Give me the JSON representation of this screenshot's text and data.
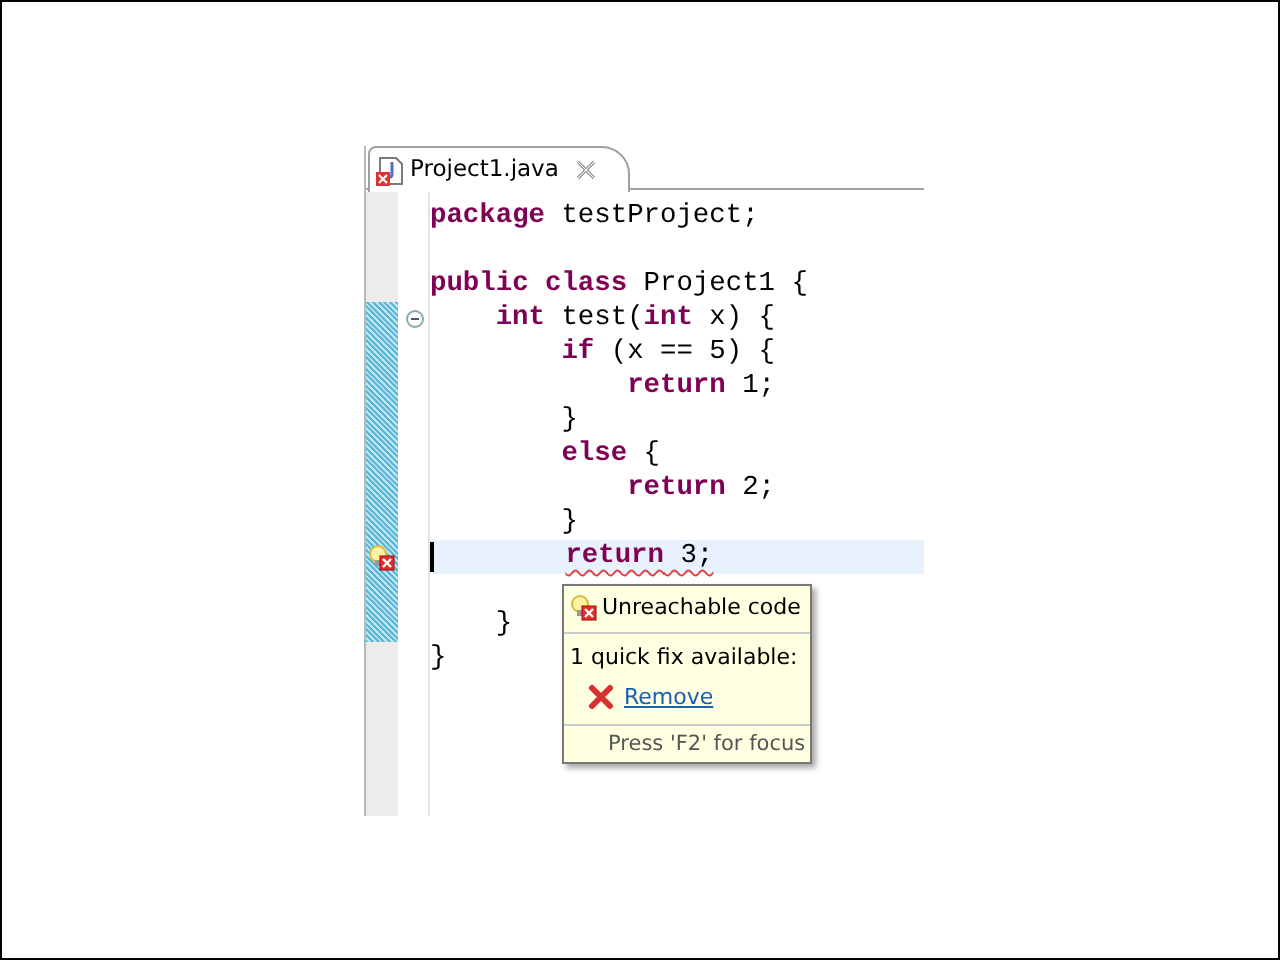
{
  "tab": {
    "title": "Project1.java",
    "selected": true
  },
  "lines": [
    {
      "tokens": [
        {
          "text": "package",
          "kind": "keyword"
        },
        {
          "text": " testProject;",
          "kind": "plain"
        }
      ],
      "blank_after": true
    },
    {
      "tokens": [
        {
          "text": "public class",
          "kind": "keyword"
        },
        {
          "text": " Project1 {",
          "kind": "plain"
        }
      ],
      "children": [
        {
          "tokens": [
            {
              "text": "int",
              "kind": "keyword"
            },
            {
              "text": " test(",
              "kind": "plain"
            },
            {
              "text": "int",
              "kind": "keyword"
            },
            {
              "text": " x) {",
              "kind": "plain"
            }
          ],
          "changed": true,
          "expanded": true,
          "children": [
            {
              "tokens": [
                {
                  "text": "if",
                  "kind": "keyword"
                },
                {
                  "text": " (x == 5) {",
                  "kind": "plain"
                }
              ],
              "changed": true,
              "children": [
                {
                  "tokens": [
                    {
                      "text": "return",
                      "kind": "keyword"
                    },
                    {
                      "text": " 1;",
                      "kind": "plain"
                    }
                  ],
                  "changed": true
                }
              ]
            },
            {
              "tokens": [
                {
                  "text": "}",
                  "kind": "plain"
                }
              ],
              "changed": true
            },
            {
              "tokens": [
                {
                  "text": "else",
                  "kind": "keyword"
                },
                {
                  "text": " {",
                  "kind": "plain"
                }
              ],
              "changed": true,
              "children": [
                {
                  "tokens": [
                    {
                      "text": "return",
                      "kind": "keyword"
                    },
                    {
                      "text": " 2;",
                      "kind": "plain"
                    }
                  ],
                  "changed": true
                }
              ]
            },
            {
              "tokens": [
                {
                  "text": "}",
                  "kind": "plain"
                }
              ],
              "changed": true
            },
            {
              "tokens": [
                {
                  "text": "return",
                  "kind": "keyword",
                  "error": true
                },
                {
                  "text": " 3;",
                  "kind": "plain",
                  "error": true
                }
              ],
              "changed": true,
              "current": true,
              "problem": true,
              "blank_after": true
            }
          ]
        },
        {
          "tokens": [
            {
              "text": "}",
              "kind": "plain"
            }
          ],
          "changed": true
        }
      ]
    },
    {
      "tokens": [
        {
          "text": "}",
          "kind": "plain"
        }
      ]
    }
  ],
  "popup": {
    "title": "Unreachable code",
    "summary": "1 quick fix available:",
    "fixes": [
      {
        "label": "Remove"
      }
    ],
    "footer": "Press 'F2' for focus"
  }
}
